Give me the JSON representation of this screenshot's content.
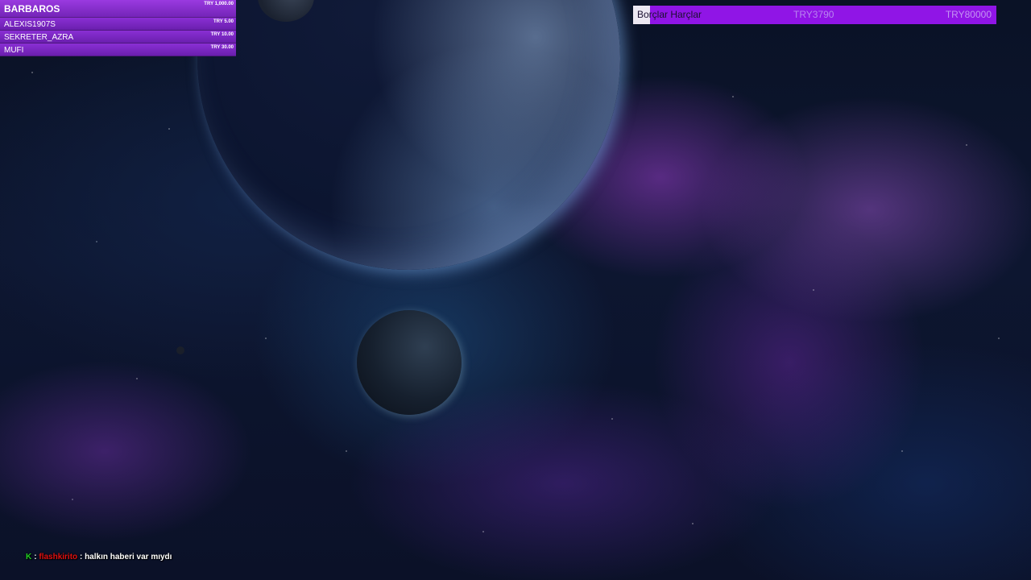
{
  "leaderboard": {
    "top": {
      "name": "BARBAROS",
      "amount": "TRY 1,000.00"
    },
    "entries": [
      {
        "name": "ALEXIS1907S",
        "amount": "TRY 5.00"
      },
      {
        "name": "SEKRETER_AZRA",
        "amount": "TRY 10.00"
      },
      {
        "name": "MUFI",
        "amount": "TRY 30.00"
      }
    ]
  },
  "goal": {
    "title": "Borçlar Harçlar",
    "current": "TRY3790",
    "target": "TRY80000",
    "progress": 0.047,
    "fill_color": "#ece8f2",
    "bar_color": "#9015e6"
  },
  "chat": {
    "badge_icon": "kick-icon",
    "badge_glyph": "K",
    "separator_left": ":",
    "username": "flashkirito",
    "separator": ":",
    "message": "halkın haberi var mıydı"
  }
}
